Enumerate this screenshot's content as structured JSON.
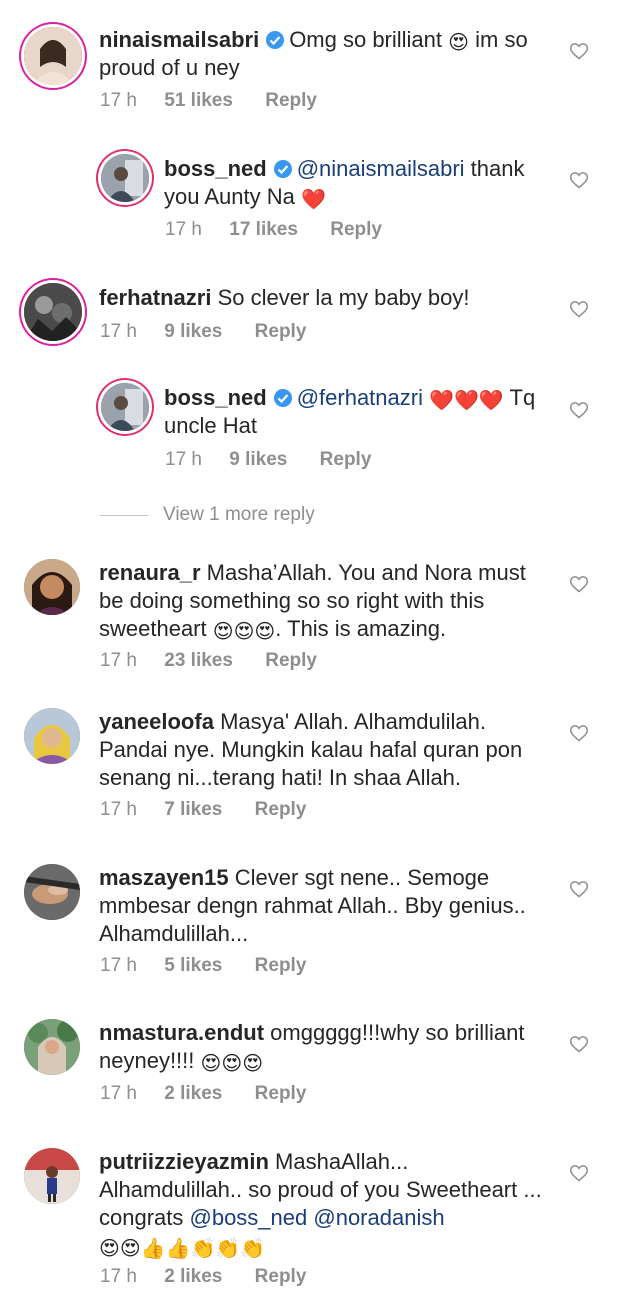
{
  "comments": [
    {
      "username": "ninaismailsabri",
      "verified": true,
      "text_parts": [
        "Omg so brilliant ",
        "😍",
        " im so proud of u ney"
      ],
      "time": "17 h",
      "likes": "51 likes",
      "reply": "Reply"
    },
    {
      "username": "boss_ned",
      "verified": true,
      "mention": "@ninaismailsabri",
      "text_parts": [
        " thank you Aunty Na ",
        "❤️"
      ],
      "time": "17 h",
      "likes": "17 likes",
      "reply": "Reply"
    },
    {
      "username": "ferhatnazri",
      "verified": false,
      "text_parts": [
        "So clever la my baby boy!"
      ],
      "time": "17 h",
      "likes": "9 likes",
      "reply": "Reply"
    },
    {
      "username": "boss_ned",
      "verified": true,
      "mention": "@ferhatnazri",
      "text_parts": [
        " ",
        "❤️❤️❤️",
        " Tq uncle Hat"
      ],
      "time": "17 h",
      "likes": "9 likes",
      "reply": "Reply"
    },
    {
      "username": "renaura_r",
      "verified": false,
      "text_parts": [
        "Masha’Allah. You and Nora must be doing something so so right with this sweetheart ",
        "😍😍😍",
        ". This is amazing."
      ],
      "time": "17 h",
      "likes": "23 likes",
      "reply": "Reply"
    },
    {
      "username": "yaneeloofa",
      "verified": false,
      "text_parts": [
        "Masya' Allah. Alhamdulilah. Pandai nye. Mungkin kalau hafal quran pon senang ni...terang hati! In shaa Allah."
      ],
      "time": "17 h",
      "likes": "7 likes",
      "reply": "Reply"
    },
    {
      "username": "maszayen15",
      "verified": false,
      "text_parts": [
        "Clever sgt nene.. Semoge mmbesar dengn rahmat Allah.. Bby genius.. Alhamdulillah..."
      ],
      "time": "17 h",
      "likes": "5 likes",
      "reply": "Reply"
    },
    {
      "username": "nmastura.endut",
      "verified": false,
      "text_parts": [
        "omggggg!!!why so brilliant neyney!!!! ",
        "😍😍😍"
      ],
      "time": "17 h",
      "likes": "2 likes",
      "reply": "Reply"
    },
    {
      "username": "putriizzieyazmin",
      "verified": false,
      "text_parts": [
        "MashaAllah... Alhamdulillah.. so proud of you Sweetheart ... congrats "
      ],
      "mentions": [
        "@boss_ned",
        "@noradanish"
      ],
      "text_tail": "😍😍👍👍👏👏👏",
      "time": "17 h",
      "likes": "2 likes",
      "reply": "Reply"
    }
  ],
  "view_more": "View 1 more reply",
  "icons": {
    "like": "heart-outline-icon",
    "verified": "verified-badge-icon"
  },
  "colors": {
    "verified": "#3897f0",
    "mention": "#1a3e7a",
    "meta": "#8e8e8e",
    "ring": "#d6249f"
  }
}
